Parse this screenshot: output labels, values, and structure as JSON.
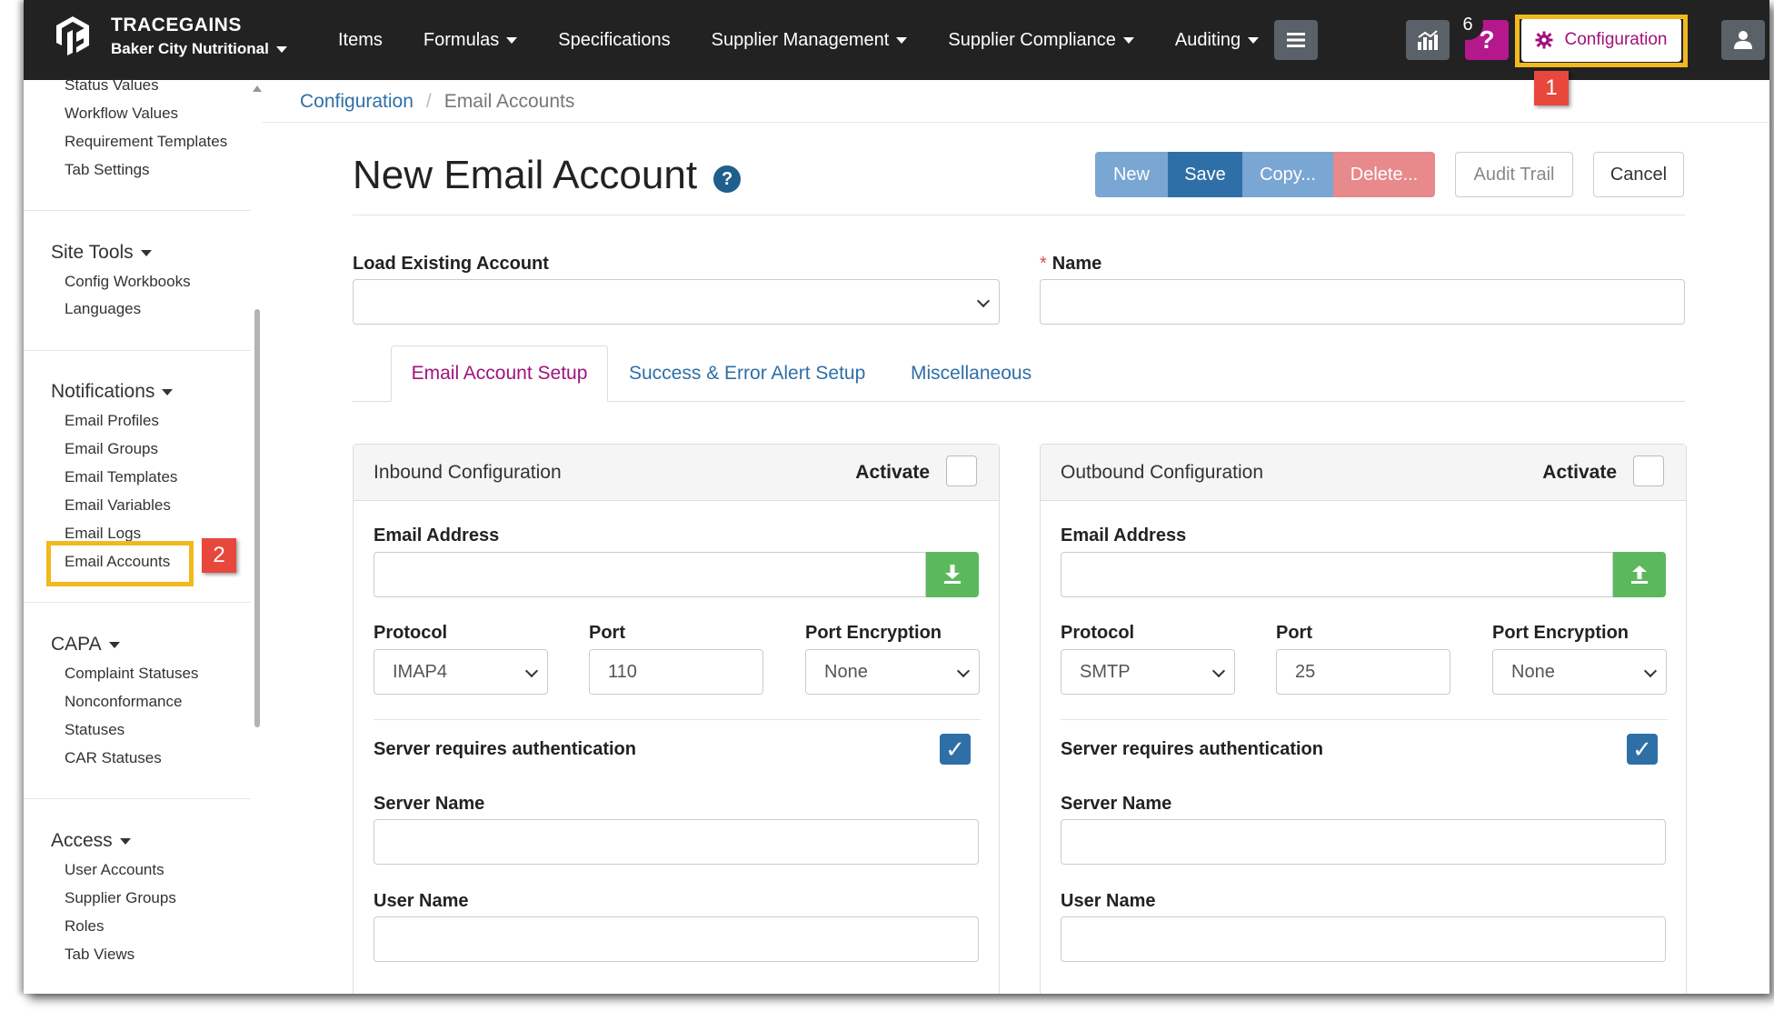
{
  "brand": {
    "name": "TRACEGAINS",
    "company": "Baker City Nutritional"
  },
  "nav": {
    "items": [
      {
        "label": "Items",
        "dropdown": false
      },
      {
        "label": "Formulas",
        "dropdown": true
      },
      {
        "label": "Specifications",
        "dropdown": false
      },
      {
        "label": "Supplier Management",
        "dropdown": true
      },
      {
        "label": "Supplier Compliance",
        "dropdown": true
      },
      {
        "label": "Auditing",
        "dropdown": true
      }
    ],
    "notification_count": "6",
    "help_label": "?",
    "configuration_label": "Configuration"
  },
  "callouts": {
    "one": "1",
    "two": "2"
  },
  "sidebar": {
    "top_items": [
      "Status Values",
      "Workflow Values",
      "Requirement Templates",
      "Tab Settings"
    ],
    "site_tools": {
      "title": "Site Tools",
      "items": [
        "Config Workbooks",
        "Languages"
      ]
    },
    "notifications": {
      "title": "Notifications",
      "items": [
        "Email Profiles",
        "Email Groups",
        "Email Templates",
        "Email Variables",
        "Email Logs",
        "Email Accounts"
      ]
    },
    "capa": {
      "title": "CAPA",
      "items": [
        "Complaint Statuses",
        "Nonconformance",
        "Statuses",
        "CAR Statuses"
      ]
    },
    "access": {
      "title": "Access",
      "items": [
        "User Accounts",
        "Supplier Groups",
        "Roles",
        "Tab Views"
      ]
    }
  },
  "breadcrumb": {
    "parent": "Configuration",
    "separator": "/",
    "current": "Email Accounts"
  },
  "page": {
    "title": "New Email Account",
    "help": "?"
  },
  "toolbar": {
    "new": "New",
    "save": "Save",
    "copy": "Copy...",
    "delete": "Delete...",
    "audit": "Audit Trail",
    "cancel": "Cancel"
  },
  "form": {
    "load_existing_label": "Load Existing Account",
    "load_existing_value": "",
    "name_required": "*",
    "name_label": "Name",
    "name_value": ""
  },
  "tabs": [
    "Email Account Setup",
    "Success & Error Alert Setup",
    "Miscellaneous"
  ],
  "inbound": {
    "title": "Inbound Configuration",
    "activate_label": "Activate",
    "activated": false,
    "email_label": "Email Address",
    "email_value": "",
    "protocol_label": "Protocol",
    "protocol_value": "IMAP4",
    "port_label": "Port",
    "port_value": "110",
    "encryption_label": "Port Encryption",
    "encryption_value": "None",
    "auth_label": "Server requires authentication",
    "auth_checked": true,
    "server_label": "Server Name",
    "server_value": "",
    "user_label": "User Name",
    "user_value": ""
  },
  "outbound": {
    "title": "Outbound Configuration",
    "activate_label": "Activate",
    "activated": false,
    "email_label": "Email Address",
    "email_value": "",
    "protocol_label": "Protocol",
    "protocol_value": "SMTP",
    "port_label": "Port",
    "port_value": "25",
    "encryption_label": "Port Encryption",
    "encryption_value": "None",
    "auth_label": "Server requires authentication",
    "auth_checked": true,
    "server_label": "Server Name",
    "server_value": "",
    "user_label": "User Name",
    "user_value": ""
  },
  "colors": {
    "nav_bg": "#222222",
    "link_blue": "#2f6fa7",
    "accent_magenta": "#a1127c",
    "highlight_yellow": "#f2b91e",
    "callout_red": "#e8483c",
    "addon_green": "#5cb85c"
  },
  "icons": [
    "tracegains-logo-icon",
    "chevron-down-icon",
    "hamburger-menu-icon",
    "analytics-chart-icon",
    "help-icon",
    "gear-icon",
    "user-icon",
    "download-icon",
    "upload-icon",
    "checkmark-icon"
  ]
}
